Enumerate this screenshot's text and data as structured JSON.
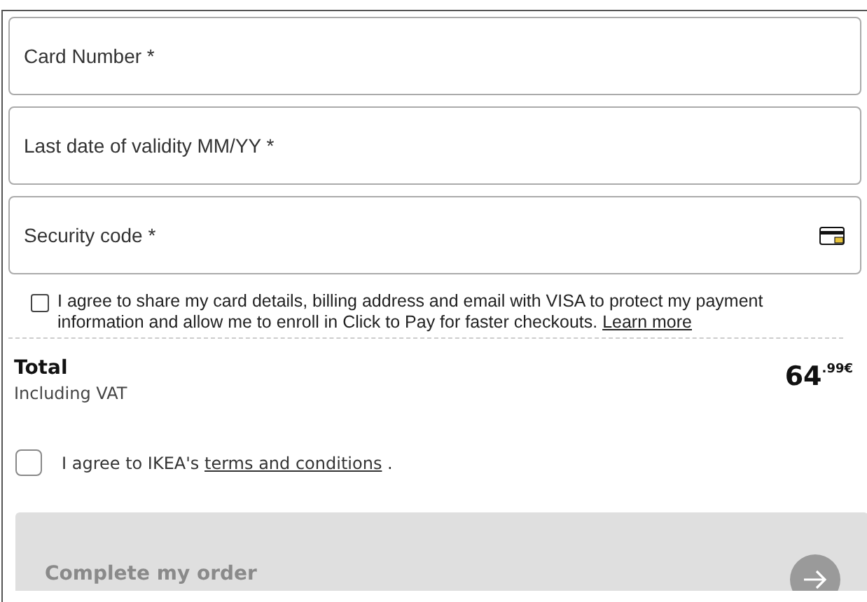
{
  "fields": [
    {
      "placeholder": "Card Number *",
      "kind": "plain"
    },
    {
      "placeholder": "Last date of validity MM/YY *",
      "kind": "plain"
    },
    {
      "placeholder": "Security code *",
      "kind": "card"
    }
  ],
  "visa_consent": {
    "checked": false,
    "text": "I agree to share my card details, billing address and email with VISA to protect my payment information and allow me to enroll in Click to Pay for faster checkouts.",
    "link": "Learn more"
  },
  "total": {
    "label": "Total",
    "note": "Including VAT",
    "price": "64$^{.99€}$"
  },
  "terms": {
    "checked": false,
    "text_before": "I agree to IKEA's",
    "link": "terms and conditions",
    "text_after": "."
  },
  "order_button": {
    "label": "Complete my order",
    "disabled": true
  }
}
